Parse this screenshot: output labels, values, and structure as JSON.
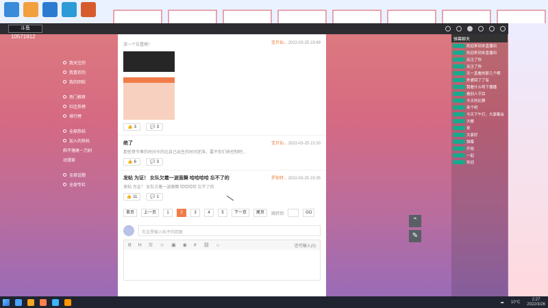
{
  "app": {
    "logo": "斗鱼",
    "room_id": "10571912",
    "window_controls": [
      "─",
      "□",
      "✕"
    ]
  },
  "left_nav": [
    "我关注的",
    "我喜欢的",
    "我的回帖",
    "热门推荐",
    "社区热榜",
    "排行榜",
    "全部热帖",
    "加入的热帖",
    "斜不落尾一刀剁",
    "动漫家",
    "全部话题",
    "全部专栏"
  ],
  "posts": [
    {
      "snippet": "求一个位置啊！",
      "author": "宝贝仙...",
      "date": "2022-03-25 23:49",
      "likes": "3",
      "comments": "3"
    },
    {
      "title": "绝了",
      "snippet": "那些哥节奏的时间卡的比自己出生的时间还准，要不你们来控制吧...",
      "author": "宝贝仙...",
      "date": "2022-03-25 22:20",
      "likes": "6",
      "comments": "3"
    },
    {
      "title": "发帖 为证！ 女队欠着一波面舞 哈哈哈哈 忘不了的",
      "snippet": "发帖 为证！ 女队欠着一波面舞 哈哈哈哈 忘不了的",
      "author": "罗伯特...",
      "date": "2022-03-25 23:35",
      "likes": "11",
      "comments": "1"
    }
  ],
  "pager": {
    "first": "首页",
    "prev": "上一页",
    "pages": [
      "1",
      "2",
      "3",
      "4",
      "5"
    ],
    "active_page": "2",
    "next": "下一页",
    "last": "尾页",
    "goto": "跳转到",
    "go": "GO"
  },
  "reply": {
    "placeholder": "在这里输入帖子的回复",
    "char_count": "还可输入(0)"
  },
  "chat": {
    "header": "弹幕聊天",
    "messages": [
      "欢迎来到本直播间",
      "欢迎来到本直播间",
      "关注了你",
      "关注了你",
      "天一直看的那几个啊",
      "外婆回了了有",
      "我看什么呀下播播",
      "看别人节目",
      "今天的比赛",
      "来个吧",
      "今天下午打，大家都会",
      "大概",
      "来",
      "大家好",
      "弹幕",
      "开始",
      "一起",
      "欢迎"
    ]
  },
  "taskbar": {
    "weather": "10°C",
    "time": "2:27",
    "date": "2022/3/26"
  }
}
